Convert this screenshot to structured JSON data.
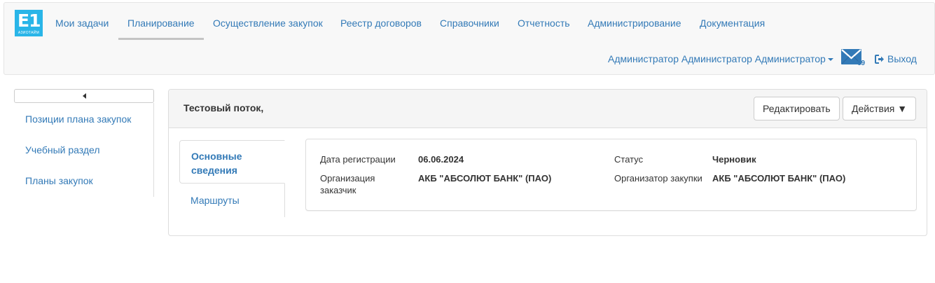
{
  "logo": {
    "big": "E1",
    "small": "АЗИОТАЙМ"
  },
  "nav": {
    "items": [
      "Мои задачи",
      "Планирование",
      "Осуществление закупок",
      "Реестр договоров",
      "Справочники",
      "Отчетность",
      "Администрирование",
      "Документация"
    ],
    "active": "Планирование"
  },
  "user": {
    "name": "Администратор Администратор Администратор",
    "mail_count": "69",
    "logout_label": "Выход"
  },
  "sidebar": {
    "items": [
      {
        "label": "Позиции плана закупок"
      },
      {
        "label": "Учебный раздел"
      },
      {
        "label": "Планы закупок"
      }
    ]
  },
  "panel": {
    "title": "Тестовый поток,",
    "edit_label": "Редактировать",
    "actions_label": "Действия ▼"
  },
  "tabs": [
    {
      "label": "Основные сведения",
      "active": true
    },
    {
      "label": "Маршруты",
      "active": false
    }
  ],
  "fields": {
    "reg_date": {
      "label": "Дата регистрации",
      "value": "06.06.2024"
    },
    "customer": {
      "label": "Организация заказчик",
      "value": "АКБ \"АБСОЛЮТ БАНК\" (ПАО)"
    },
    "status": {
      "label": "Статус",
      "value": "Черновик"
    },
    "organizer": {
      "label": "Организатор закупки",
      "value": "АКБ \"АБСОЛЮТ БАНК\" (ПАО)"
    }
  },
  "colors": {
    "link": "#337ab7",
    "logo_bg": "#29b5e8",
    "navbar_bg": "#f8f8f8"
  },
  "icons": [
    "mail-icon",
    "logout-icon",
    "collapse-left-icon",
    "caret-down-icon"
  ]
}
